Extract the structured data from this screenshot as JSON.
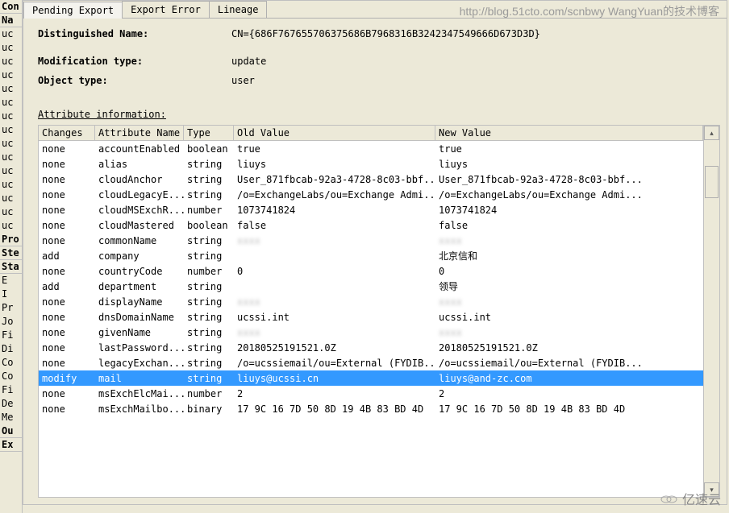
{
  "watermark": "http://blog.51cto.com/scnbwy WangYuan的技术博客",
  "logo_text": "亿速云",
  "left_strip": {
    "headers": [
      "Con",
      "Na"
    ],
    "items": [
      "uc",
      "uc",
      "uc",
      "uc",
      "uc",
      "uc",
      "uc",
      "uc",
      "uc",
      "uc",
      "uc",
      "uc",
      "uc",
      "uc",
      "uc"
    ],
    "groups": [
      "Pro",
      "Ste",
      "Sta"
    ],
    "items2": [
      "E",
      "I",
      "Pr",
      "Jo",
      "Fi",
      "Di",
      "Co",
      "Co",
      "Fi",
      "De",
      "Me"
    ],
    "footer": [
      "Ou",
      "Ex"
    ]
  },
  "tabs": [
    {
      "label": "Pending Export",
      "active": true
    },
    {
      "label": "Export Error",
      "active": false
    },
    {
      "label": "Lineage",
      "active": false
    }
  ],
  "dn_label": "Distinguished Name:",
  "dn_value": "CN={686F767655706375686B7968316B3242347549666D673D3D}",
  "modtype_label": "Modification type:",
  "modtype_value": "update",
  "objtype_label": "Object type:",
  "objtype_value": "user",
  "section_title": "Attribute information:",
  "columns": [
    "Changes",
    "Attribute Name",
    "Type",
    "Old Value",
    "New Value"
  ],
  "rows": [
    {
      "changes": "none",
      "name": "accountEnabled",
      "type": "boolean",
      "old": "true",
      "new": "true"
    },
    {
      "changes": "none",
      "name": "alias",
      "type": "string",
      "old": "liuys",
      "new": "liuys"
    },
    {
      "changes": "none",
      "name": "cloudAnchor",
      "type": "string",
      "old": "User_871fbcab-92a3-4728-8c03-bbf...",
      "new": "User_871fbcab-92a3-4728-8c03-bbf..."
    },
    {
      "changes": "none",
      "name": "cloudLegacyE...",
      "type": "string",
      "old": "/o=ExchangeLabs/ou=Exchange Admi...",
      "new": "/o=ExchangeLabs/ou=Exchange Admi..."
    },
    {
      "changes": "none",
      "name": "cloudMSExchR...",
      "type": "number",
      "old": "1073741824",
      "new": "1073741824"
    },
    {
      "changes": "none",
      "name": "cloudMastered",
      "type": "boolean",
      "old": "false",
      "new": "false"
    },
    {
      "changes": "none",
      "name": "commonName",
      "type": "string",
      "old": "",
      "new": "",
      "blur": true
    },
    {
      "changes": "add",
      "name": "company",
      "type": "string",
      "old": "",
      "new": "北京信和"
    },
    {
      "changes": "none",
      "name": "countryCode",
      "type": "number",
      "old": "0",
      "new": "0"
    },
    {
      "changes": "add",
      "name": "department",
      "type": "string",
      "old": "",
      "new": "领导"
    },
    {
      "changes": "none",
      "name": "displayName",
      "type": "string",
      "old": "",
      "new": "",
      "blur": true
    },
    {
      "changes": "none",
      "name": "dnsDomainName",
      "type": "string",
      "old": "ucssi.int",
      "new": "ucssi.int"
    },
    {
      "changes": "none",
      "name": "givenName",
      "type": "string",
      "old": "",
      "new": "",
      "blur": true
    },
    {
      "changes": "none",
      "name": "lastPassword...",
      "type": "string",
      "old": "20180525191521.0Z",
      "new": "20180525191521.0Z"
    },
    {
      "changes": "none",
      "name": "legacyExchan...",
      "type": "string",
      "old": "/o=ucssiemail/ou=External (FYDIB...",
      "new": "/o=ucssiemail/ou=External (FYDIB..."
    },
    {
      "changes": "modify",
      "name": "mail",
      "type": "string",
      "old": "liuys@ucssi.cn",
      "new": "liuys@and-zc.com",
      "selected": true
    },
    {
      "changes": "none",
      "name": "msExchElcMai...",
      "type": "number",
      "old": "2",
      "new": "2"
    },
    {
      "changes": "none",
      "name": "msExchMailbo...",
      "type": "binary",
      "old": "17 9C 16 7D 50 8D 19 4B 83 BD 4D",
      "new": "17 9C 16 7D 50 8D 19 4B 83 BD 4D"
    }
  ]
}
